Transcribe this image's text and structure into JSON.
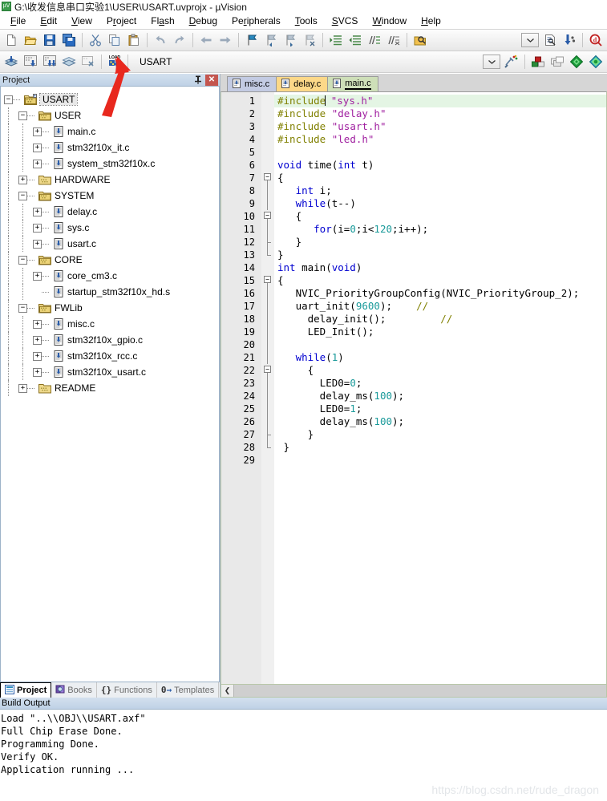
{
  "window": {
    "title": "G:\\收发信息串口实验1\\USER\\USART.uvprojx - µVision",
    "app_icon": "uvision-icon"
  },
  "menubar": {
    "items": [
      {
        "label": "File"
      },
      {
        "label": "Edit"
      },
      {
        "label": "View"
      },
      {
        "label": "Project"
      },
      {
        "label": "Flash"
      },
      {
        "label": "Debug"
      },
      {
        "label": "Peripherals"
      },
      {
        "label": "Tools"
      },
      {
        "label": "SVCS"
      },
      {
        "label": "Window"
      },
      {
        "label": "Help"
      }
    ]
  },
  "toolbar_main": {
    "buttons": [
      {
        "name": "new-file-icon"
      },
      {
        "name": "open-file-icon"
      },
      {
        "name": "save-icon"
      },
      {
        "name": "save-all-icon"
      },
      {
        "name": "cut-icon"
      },
      {
        "name": "copy-icon"
      },
      {
        "name": "paste-icon"
      },
      {
        "name": "undo-icon"
      },
      {
        "name": "redo-icon"
      },
      {
        "name": "navigate-back-icon"
      },
      {
        "name": "navigate-forward-icon"
      },
      {
        "name": "bookmark-toggle-icon"
      },
      {
        "name": "bookmark-prev-icon"
      },
      {
        "name": "bookmark-next-icon"
      },
      {
        "name": "bookmark-clear-icon"
      },
      {
        "name": "indent-right-icon"
      },
      {
        "name": "indent-left-icon"
      },
      {
        "name": "comment-icon"
      },
      {
        "name": "uncomment-icon"
      },
      {
        "name": "find-in-files-icon"
      }
    ],
    "right_buttons": [
      {
        "name": "search-combo-dropdown"
      },
      {
        "name": "browse-info-icon"
      },
      {
        "name": "configure-icon"
      },
      {
        "name": "debug-find-icon"
      }
    ]
  },
  "toolbar_build": {
    "buttons": [
      {
        "name": "translate-icon"
      },
      {
        "name": "build-icon"
      },
      {
        "name": "rebuild-all-icon"
      },
      {
        "name": "batch-build-icon"
      },
      {
        "name": "stop-build-icon"
      },
      {
        "name": "download-icon",
        "label": "LOAD"
      }
    ],
    "project_target": "USART",
    "right_buttons": [
      {
        "name": "target-combo-dropdown"
      },
      {
        "name": "options-for-target-icon"
      },
      {
        "name": "manage-project-items-icon"
      },
      {
        "name": "manage-multi-project-icon"
      },
      {
        "name": "pack-installer-icon"
      },
      {
        "name": "manage-run-time-env-icon"
      }
    ]
  },
  "annotation": {
    "arrow_color": "#e8281e",
    "points_to": "download-button"
  },
  "project_pane": {
    "header_title": "Project",
    "pin_icon": "pin-icon",
    "close_icon": "close-icon",
    "tree": [
      {
        "label": "USART",
        "depth": 0,
        "state": "expanded",
        "icon": "project-icon",
        "selected": true
      },
      {
        "label": "USER",
        "depth": 1,
        "state": "expanded",
        "icon": "group-icon"
      },
      {
        "label": "main.c",
        "depth": 2,
        "state": "collapsed",
        "icon": "c-file-icon"
      },
      {
        "label": "stm32f10x_it.c",
        "depth": 2,
        "state": "collapsed",
        "icon": "c-file-icon"
      },
      {
        "label": "system_stm32f10x.c",
        "depth": 2,
        "state": "collapsed",
        "icon": "c-file-icon"
      },
      {
        "label": "HARDWARE",
        "depth": 1,
        "state": "collapsed",
        "icon": "group-closed-icon"
      },
      {
        "label": "SYSTEM",
        "depth": 1,
        "state": "expanded",
        "icon": "group-icon"
      },
      {
        "label": "delay.c",
        "depth": 2,
        "state": "collapsed",
        "icon": "c-file-icon"
      },
      {
        "label": "sys.c",
        "depth": 2,
        "state": "collapsed",
        "icon": "c-file-icon"
      },
      {
        "label": "usart.c",
        "depth": 2,
        "state": "collapsed",
        "icon": "c-file-icon"
      },
      {
        "label": "CORE",
        "depth": 1,
        "state": "expanded",
        "icon": "group-icon"
      },
      {
        "label": "core_cm3.c",
        "depth": 2,
        "state": "collapsed",
        "icon": "c-file-icon"
      },
      {
        "label": "startup_stm32f10x_hd.s",
        "depth": 2,
        "state": "leaf",
        "icon": "c-file-icon"
      },
      {
        "label": "FWLib",
        "depth": 1,
        "state": "expanded",
        "icon": "group-icon"
      },
      {
        "label": "misc.c",
        "depth": 2,
        "state": "collapsed",
        "icon": "c-file-icon"
      },
      {
        "label": "stm32f10x_gpio.c",
        "depth": 2,
        "state": "collapsed",
        "icon": "c-file-icon"
      },
      {
        "label": "stm32f10x_rcc.c",
        "depth": 2,
        "state": "collapsed",
        "icon": "c-file-icon"
      },
      {
        "label": "stm32f10x_usart.c",
        "depth": 2,
        "state": "collapsed",
        "icon": "c-file-icon"
      },
      {
        "label": "README",
        "depth": 1,
        "state": "collapsed",
        "icon": "group-closed-icon"
      }
    ],
    "bottom_tabs": [
      {
        "label": "Project",
        "icon": "project-tab-icon",
        "active": true
      },
      {
        "label": "Books",
        "icon": "books-tab-icon",
        "active": false
      },
      {
        "label": "Functions",
        "icon": "functions-tab-icon",
        "active": false
      },
      {
        "label": "Templates",
        "icon": "templates-tab-icon",
        "active": false
      }
    ]
  },
  "editor": {
    "tabs": [
      {
        "label": "misc.c",
        "icon": "c-file-icon",
        "active": false,
        "color": "#c3cbe3"
      },
      {
        "label": "delay.c",
        "icon": "c-file-icon",
        "active": false,
        "color": "#fcd888"
      },
      {
        "label": "main.c",
        "icon": "c-file-icon",
        "active": true,
        "color": "#cedfb8"
      }
    ],
    "current_line": 1,
    "lines": [
      {
        "n": 1,
        "fold": "",
        "tokens": [
          {
            "t": "#include",
            "c": "pp"
          },
          {
            "t": "CARET",
            "c": "caret"
          },
          {
            "t": " ",
            "c": "pl"
          },
          {
            "t": "\"sys.h\"",
            "c": "st"
          }
        ]
      },
      {
        "n": 2,
        "fold": "",
        "tokens": [
          {
            "t": "#include",
            "c": "pp"
          },
          {
            "t": " ",
            "c": "pl"
          },
          {
            "t": "\"delay.h\"",
            "c": "st"
          }
        ]
      },
      {
        "n": 3,
        "fold": "",
        "tokens": [
          {
            "t": "#include",
            "c": "pp"
          },
          {
            "t": " ",
            "c": "pl"
          },
          {
            "t": "\"usart.h\"",
            "c": "st"
          }
        ]
      },
      {
        "n": 4,
        "fold": "",
        "tokens": [
          {
            "t": "#include",
            "c": "pp"
          },
          {
            "t": " ",
            "c": "pl"
          },
          {
            "t": "\"led.h\"",
            "c": "st"
          }
        ]
      },
      {
        "n": 5,
        "fold": "",
        "tokens": []
      },
      {
        "n": 6,
        "fold": "",
        "tokens": [
          {
            "t": "void",
            "c": "k"
          },
          {
            "t": " time(",
            "c": "pl"
          },
          {
            "t": "int",
            "c": "k"
          },
          {
            "t": " t)",
            "c": "pl"
          }
        ]
      },
      {
        "n": 7,
        "fold": "minus",
        "tokens": [
          {
            "t": "{",
            "c": "pl"
          }
        ]
      },
      {
        "n": 8,
        "fold": "bar",
        "tokens": [
          {
            "t": "   ",
            "c": "pl"
          },
          {
            "t": "int",
            "c": "k"
          },
          {
            "t": " i;",
            "c": "pl"
          }
        ]
      },
      {
        "n": 9,
        "fold": "bar",
        "tokens": [
          {
            "t": "   ",
            "c": "pl"
          },
          {
            "t": "while",
            "c": "k"
          },
          {
            "t": "(t--)",
            "c": "pl"
          }
        ]
      },
      {
        "n": 10,
        "fold": "minus",
        "tokens": [
          {
            "t": "   {",
            "c": "pl"
          }
        ]
      },
      {
        "n": 11,
        "fold": "bar",
        "tokens": [
          {
            "t": "      ",
            "c": "pl"
          },
          {
            "t": "for",
            "c": "k"
          },
          {
            "t": "(i=",
            "c": "pl"
          },
          {
            "t": "0",
            "c": "nm"
          },
          {
            "t": ";i<",
            "c": "pl"
          },
          {
            "t": "120",
            "c": "nm"
          },
          {
            "t": ";i++);",
            "c": "pl"
          }
        ]
      },
      {
        "n": 12,
        "fold": "endtick",
        "tokens": [
          {
            "t": "   }",
            "c": "pl"
          }
        ]
      },
      {
        "n": 13,
        "fold": "endcorner",
        "tokens": [
          {
            "t": "}",
            "c": "pl"
          }
        ]
      },
      {
        "n": 14,
        "fold": "",
        "tokens": [
          {
            "t": "int",
            "c": "k"
          },
          {
            "t": " main(",
            "c": "pl"
          },
          {
            "t": "void",
            "c": "k"
          },
          {
            "t": ")",
            "c": "pl"
          }
        ]
      },
      {
        "n": 15,
        "fold": "minus",
        "tokens": [
          {
            "t": "{",
            "c": "pl"
          }
        ]
      },
      {
        "n": 16,
        "fold": "bar",
        "tokens": [
          {
            "t": "   NVIC_PriorityGroupConfig(NVIC_PriorityGroup_2);",
            "c": "pl"
          }
        ]
      },
      {
        "n": 17,
        "fold": "bar",
        "tokens": [
          {
            "t": "   uart_init(",
            "c": "pl"
          },
          {
            "t": "9600",
            "c": "nm"
          },
          {
            "t": ");    ",
            "c": "pl"
          },
          {
            "t": "//",
            "c": "cm"
          }
        ]
      },
      {
        "n": 18,
        "fold": "bar",
        "tokens": [
          {
            "t": "     delay_init();         ",
            "c": "pl"
          },
          {
            "t": "//",
            "c": "cm"
          }
        ]
      },
      {
        "n": 19,
        "fold": "bar",
        "tokens": [
          {
            "t": "     LED_Init();",
            "c": "pl"
          }
        ]
      },
      {
        "n": 20,
        "fold": "bar",
        "tokens": []
      },
      {
        "n": 21,
        "fold": "bar",
        "tokens": [
          {
            "t": "   ",
            "c": "pl"
          },
          {
            "t": "while",
            "c": "k"
          },
          {
            "t": "(",
            "c": "pl"
          },
          {
            "t": "1",
            "c": "nm"
          },
          {
            "t": ")",
            "c": "pl"
          }
        ]
      },
      {
        "n": 22,
        "fold": "minus",
        "tokens": [
          {
            "t": "     {",
            "c": "pl"
          }
        ]
      },
      {
        "n": 23,
        "fold": "bar",
        "tokens": [
          {
            "t": "       LED0=",
            "c": "pl"
          },
          {
            "t": "0",
            "c": "nm"
          },
          {
            "t": ";",
            "c": "pl"
          }
        ]
      },
      {
        "n": 24,
        "fold": "bar",
        "tokens": [
          {
            "t": "       delay_ms(",
            "c": "pl"
          },
          {
            "t": "100",
            "c": "nm"
          },
          {
            "t": ");",
            "c": "pl"
          }
        ]
      },
      {
        "n": 25,
        "fold": "bar",
        "tokens": [
          {
            "t": "       LED0=",
            "c": "pl"
          },
          {
            "t": "1",
            "c": "nm"
          },
          {
            "t": ";",
            "c": "pl"
          }
        ]
      },
      {
        "n": 26,
        "fold": "bar",
        "tokens": [
          {
            "t": "       delay_ms(",
            "c": "pl"
          },
          {
            "t": "100",
            "c": "nm"
          },
          {
            "t": ");",
            "c": "pl"
          }
        ]
      },
      {
        "n": 27,
        "fold": "endtick",
        "tokens": [
          {
            "t": "     }",
            "c": "pl"
          }
        ]
      },
      {
        "n": 28,
        "fold": "endcorner",
        "tokens": [
          {
            "t": " }",
            "c": "pl"
          }
        ]
      },
      {
        "n": 29,
        "fold": "",
        "tokens": []
      }
    ]
  },
  "build_output": {
    "header_title": "Build Output",
    "lines": [
      "Load \"..\\\\OBJ\\\\USART.axf\"",
      "Full Chip Erase Done.",
      "Programming Done.",
      "Verify OK.",
      "Application running ..."
    ]
  },
  "watermark": {
    "text": "https://blog.csdn.net/rude_dragon"
  },
  "colors": {
    "accent_blue": "#bfd2e6",
    "tab_active_green": "#cedfb8",
    "keyword": "#0000d0",
    "string": "#a020a0",
    "number": "#1a9a9a",
    "comment": "#808000",
    "annotation_red": "#e8281e"
  }
}
